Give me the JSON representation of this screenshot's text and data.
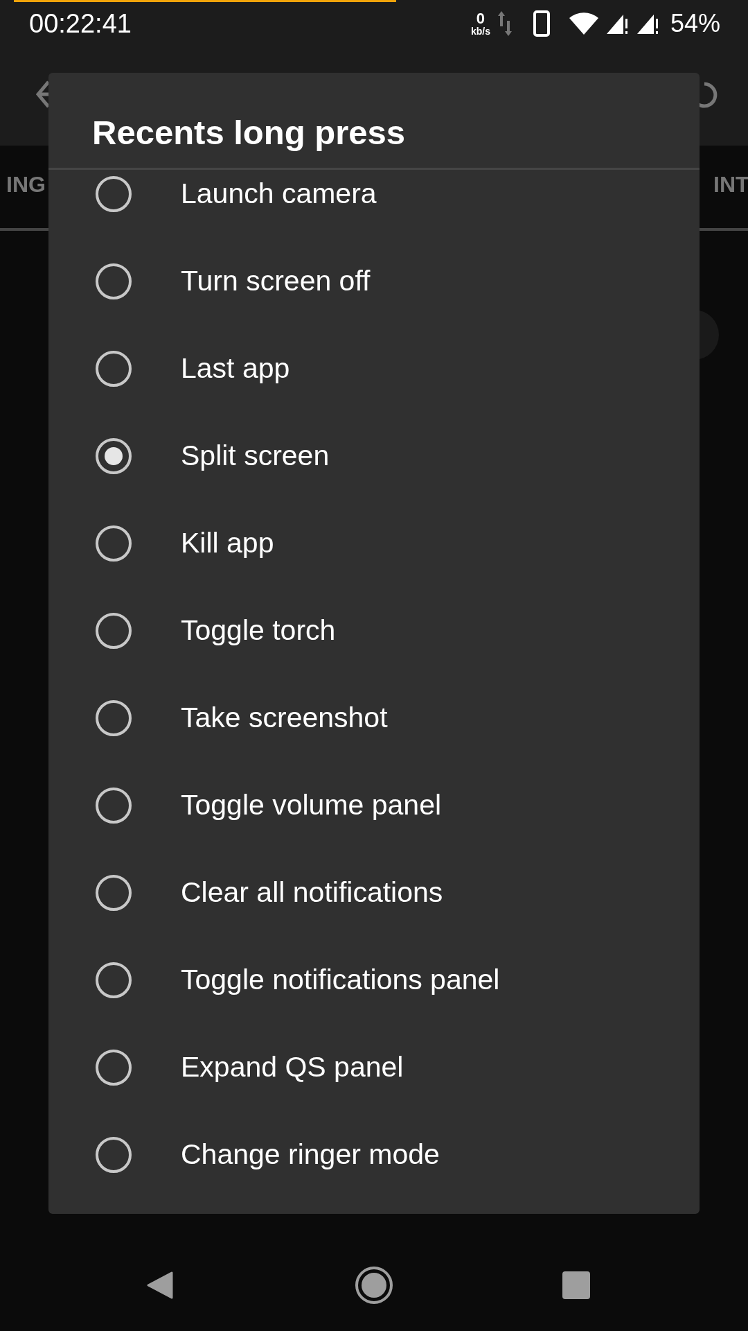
{
  "status_bar": {
    "time": "00:22:41",
    "net_speed": "0",
    "net_unit": "kb/s",
    "battery": "54%"
  },
  "background_tabs": [
    "ING",
    "INT"
  ],
  "dialog": {
    "title": "Recents long press",
    "options": [
      {
        "label": "Launch camera",
        "selected": false
      },
      {
        "label": "Turn screen off",
        "selected": false
      },
      {
        "label": "Last app",
        "selected": false
      },
      {
        "label": "Split screen",
        "selected": true
      },
      {
        "label": "Kill app",
        "selected": false
      },
      {
        "label": "Toggle torch",
        "selected": false
      },
      {
        "label": "Take screenshot",
        "selected": false
      },
      {
        "label": "Toggle volume panel",
        "selected": false
      },
      {
        "label": "Clear all notifications",
        "selected": false
      },
      {
        "label": "Toggle notifications panel",
        "selected": false
      },
      {
        "label": "Expand QS panel",
        "selected": false
      },
      {
        "label": "Change ringer mode",
        "selected": false
      }
    ]
  }
}
